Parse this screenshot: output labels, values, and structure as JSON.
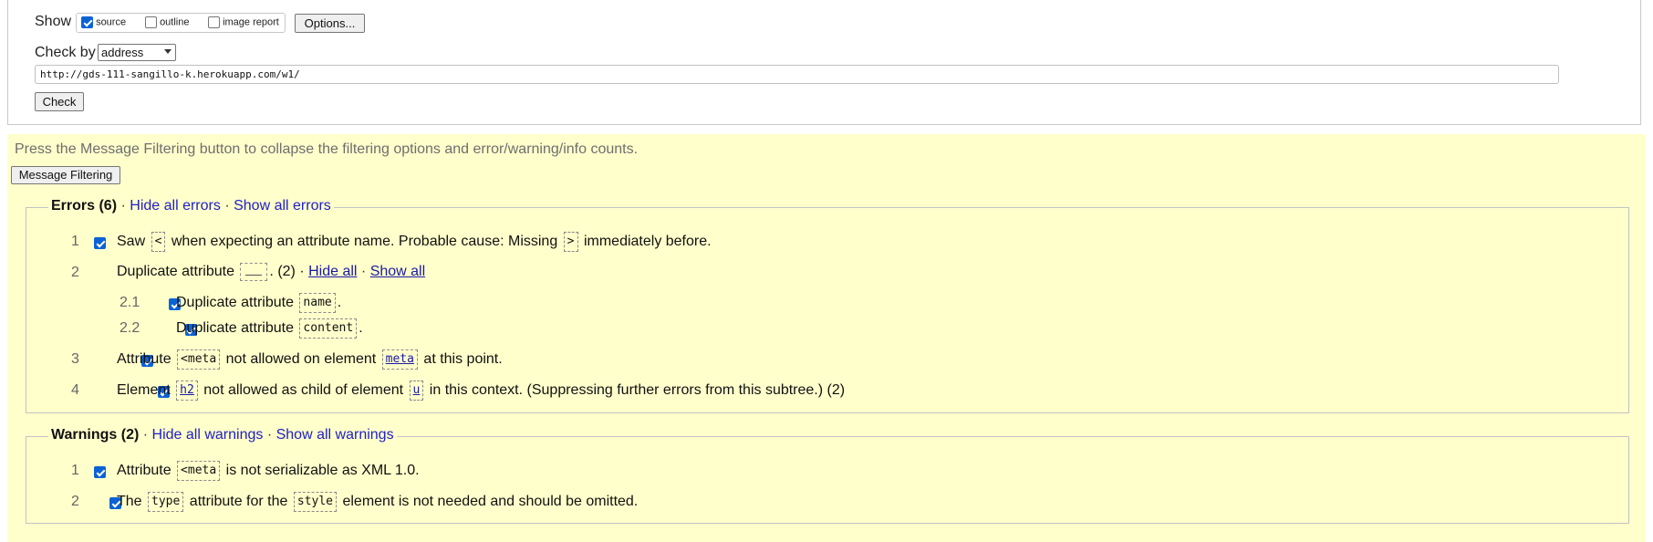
{
  "form": {
    "show_label": "Show",
    "show_options": [
      {
        "label": "source",
        "checked": true
      },
      {
        "label": "outline",
        "checked": false
      },
      {
        "label": "image report",
        "checked": false
      }
    ],
    "options_button": "Options...",
    "check_by_label": "Check by",
    "check_by_value": "address",
    "url_value": "http://gds-111-sangillo-k.herokuapp.com/w1/",
    "check_button": "Check"
  },
  "results": {
    "hint": "Press the Message Filtering button to collapse the filtering options and error/warning/info counts.",
    "message_filtering_button": "Message Filtering",
    "errors": {
      "title": "Errors (6)",
      "hide_all": "Hide all errors",
      "show_all": "Show all errors",
      "separator": "·",
      "items": [
        {
          "num": "1",
          "t1": "Saw",
          "c1": "<",
          "t2": "when expecting an attribute name. Probable cause: Missing",
          "c2": ">",
          "t3": "immediately before."
        },
        {
          "num": "2",
          "t1": "Duplicate attribute",
          "t2": ". (2) ·",
          "hide": "Hide all",
          "sep": "·",
          "show": "Show all",
          "sub": [
            {
              "num": "2.1",
              "t1": "Duplicate attribute",
              "c1": "name",
              "t2": "."
            },
            {
              "num": "2.2",
              "t1": "Duplicate attribute",
              "c1": "content",
              "t2": "."
            }
          ]
        },
        {
          "num": "3",
          "t1": "Attribute",
          "c1": "<meta",
          "t2": "not allowed on element",
          "c2": "meta",
          "t3": "at this point."
        },
        {
          "num": "4",
          "t1": "Element",
          "c1": "h2",
          "t2": "not allowed as child of element",
          "c2": "u",
          "t3": "in this context. (Suppressing further errors from this subtree.) (2)"
        }
      ]
    },
    "warnings": {
      "title": "Warnings (2)",
      "hide_all": "Hide all warnings",
      "show_all": "Show all warnings",
      "separator": "·",
      "items": [
        {
          "num": "1",
          "t1": "Attribute",
          "c1": "<meta",
          "t2": "is not serializable as XML 1.0."
        },
        {
          "num": "2",
          "t1": "The",
          "c1": "type",
          "t2": "attribute for the",
          "c2": "style",
          "t3": "element is not needed and should be omitted."
        }
      ]
    }
  }
}
